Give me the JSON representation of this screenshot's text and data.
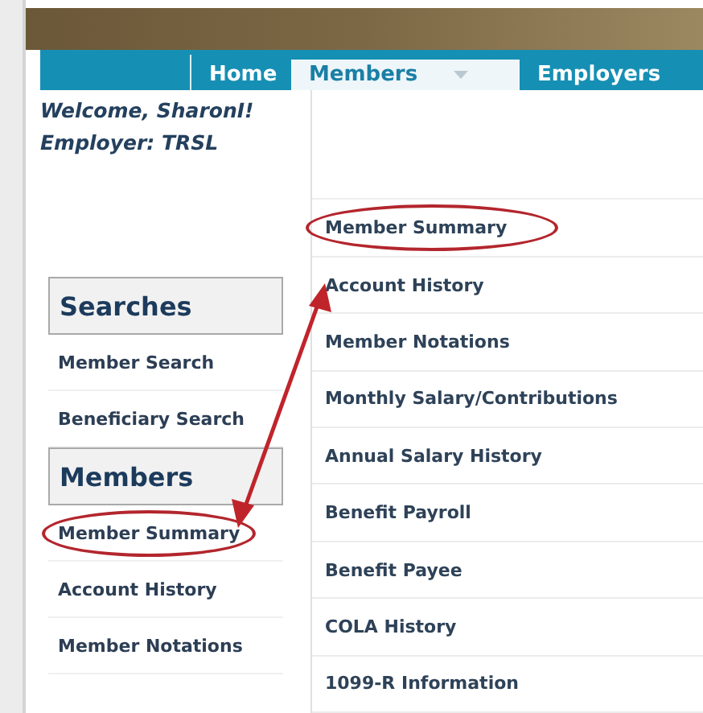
{
  "nav": {
    "tabs": [
      {
        "label": "Home",
        "selected": false,
        "caret": false
      },
      {
        "label": "Members",
        "selected": true,
        "caret": true
      },
      {
        "label": "Employers",
        "selected": false,
        "caret": false
      }
    ]
  },
  "user": {
    "welcome": "Welcome, SharonI!",
    "employer": "Employer: TRSL"
  },
  "sidebar": {
    "sections": [
      {
        "title": "Searches",
        "items": [
          {
            "label": "Member Search",
            "circled": false
          },
          {
            "label": "Beneficiary Search",
            "circled": false
          }
        ]
      },
      {
        "title": "Members",
        "items": [
          {
            "label": "Member Summary",
            "circled": true
          },
          {
            "label": "Account History",
            "circled": false
          },
          {
            "label": "Member Notations",
            "circled": false
          }
        ]
      }
    ]
  },
  "dropdown": {
    "items": [
      {
        "label": "Member Summary",
        "circled": true
      },
      {
        "label": "Account History",
        "circled": false
      },
      {
        "label": "Member Notations",
        "circled": false
      },
      {
        "label": "Monthly Salary/Contributions",
        "circled": false
      },
      {
        "label": "Annual Salary History",
        "circled": false
      },
      {
        "label": "Benefit Payroll",
        "circled": false
      },
      {
        "label": "Benefit Payee",
        "circled": false
      },
      {
        "label": "COLA History",
        "circled": false
      },
      {
        "label": "1099-R Information",
        "circled": false
      }
    ]
  }
}
